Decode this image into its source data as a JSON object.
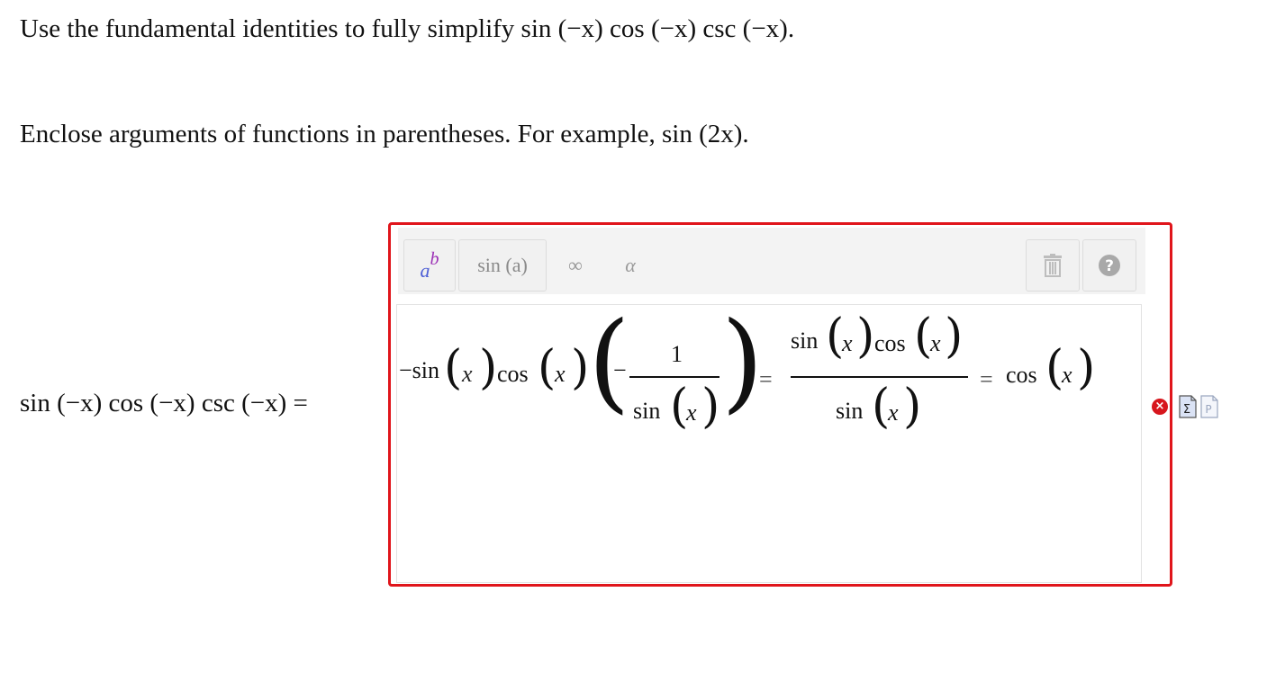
{
  "question": {
    "line1_text": "Use the fundamental identities to fully simplify",
    "line1_math": "sin (−x) cos (−x) csc (−x).",
    "line2_text": "Enclose arguments of functions in parentheses. For example,",
    "line2_math": "sin (2x)."
  },
  "lhs": {
    "expression": "sin (−x) cos (−x) csc (−x) ="
  },
  "toolbar": {
    "power_base": "a",
    "power_exp": "b",
    "sin_label": "sin (a)",
    "infinity_label": "∞",
    "alpha_label": "α"
  },
  "answer": {
    "term1": "−sin",
    "x1": "x",
    "cos1": "cos",
    "x2": "x",
    "neg": "−",
    "num1": "1",
    "den_sin1": "sin",
    "x3": "x",
    "eq1": "=",
    "num2_sin": "sin",
    "x4": "x",
    "num2_cos": "cos",
    "x5": "x",
    "den2_sin": "sin",
    "x6": "x",
    "eq2": "=",
    "final_cos": "cos",
    "x7": "x"
  },
  "status": {
    "error_icon": "x-circle-icon",
    "color_error": "#e0151b"
  }
}
